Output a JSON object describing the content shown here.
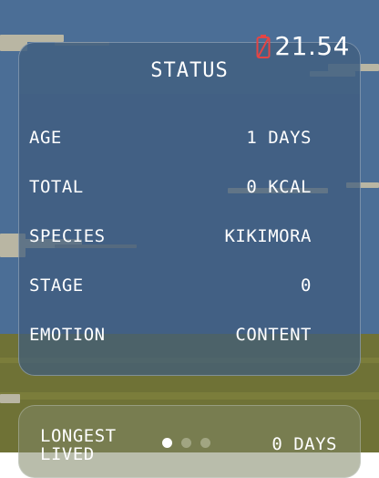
{
  "status_bar": {
    "time": "21.54",
    "battery_icon": "battery-charging-icon",
    "battery_color": "#e34545"
  },
  "status_card": {
    "title": "STATUS",
    "rows": [
      {
        "label": "AGE",
        "value": "1 DAYS"
      },
      {
        "label": "TOTAL",
        "value": "0 KCAL"
      },
      {
        "label": "SPECIES",
        "value": "KIKIMORA"
      },
      {
        "label": "STAGE",
        "value": "0"
      },
      {
        "label": "EMOTION",
        "value": "CONTENT"
      }
    ]
  },
  "record_card": {
    "label_line1": "LONGEST",
    "label_line2": "LIVED",
    "value": "0 DAYS"
  },
  "pager": {
    "total_pages": 3,
    "current_page": 1
  },
  "colors": {
    "sky": "#4b6e96",
    "ground": "#6f7236",
    "cloud": "#b9b6a3"
  }
}
